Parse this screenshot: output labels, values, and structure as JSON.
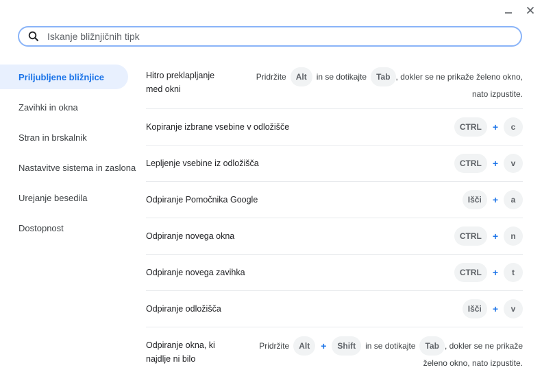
{
  "search": {
    "placeholder": "Iskanje bližnjičnih tipk"
  },
  "sidebar": {
    "items": [
      {
        "label": "Priljubljene bližnjice"
      },
      {
        "label": "Zavihki in okna"
      },
      {
        "label": "Stran in brskalnik"
      },
      {
        "label": "Nastavitve sistema in zaslona"
      },
      {
        "label": "Urejanje besedila"
      },
      {
        "label": "Dostopnost"
      }
    ]
  },
  "shortcuts": {
    "row1": {
      "label_line1": "Hitro preklapljanje",
      "label_line2": "med okni",
      "t1": "Pridržite",
      "k1": "Alt",
      "t2": "in se dotikajte",
      "k2": "Tab",
      "t3": ", dokler se ne prikaže želeno okno,",
      "t4": "nato izpustite."
    },
    "row2": {
      "label": "Kopiranje izbrane vsebine v odložišče",
      "k1": "CTRL",
      "plus": "+",
      "k2": "c"
    },
    "row3": {
      "label": "Lepljenje vsebine iz odložišča",
      "k1": "CTRL",
      "plus": "+",
      "k2": "v"
    },
    "row4": {
      "label": "Odpiranje Pomočnika Google",
      "k1": "Išči",
      "plus": "+",
      "k2": "a"
    },
    "row5": {
      "label": "Odpiranje novega okna",
      "k1": "CTRL",
      "plus": "+",
      "k2": "n"
    },
    "row6": {
      "label": "Odpiranje novega zavihka",
      "k1": "CTRL",
      "plus": "+",
      "k2": "t"
    },
    "row7": {
      "label": "Odpiranje odložišča",
      "k1": "Išči",
      "plus": "+",
      "k2": "v"
    },
    "row8": {
      "label_line1": "Odpiranje okna, ki",
      "label_line2": "najdlje ni bilo",
      "t1": "Pridržite",
      "k1": "Alt",
      "plus": "+",
      "k2": "Shift",
      "t2": "in se dotikajte",
      "k3": "Tab",
      "t3": ", dokler se ne prikaže",
      "t4": "želeno okno, nato izpustite."
    }
  },
  "colors": {
    "accent": "#1a73e8",
    "active_bg": "#e8f0fe",
    "key_bg": "#f1f3f4"
  }
}
